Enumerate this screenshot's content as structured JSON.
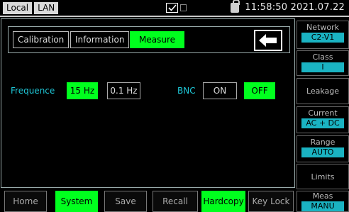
{
  "status": {
    "tags": [
      "Local",
      "LAN"
    ],
    "datetime": "11:58:50 2021.07.22"
  },
  "tabs": [
    {
      "label": "Calibration",
      "active": false
    },
    {
      "label": "Information",
      "active": false
    },
    {
      "label": "Measure",
      "active": true
    }
  ],
  "frequence": {
    "label": "Frequence",
    "options": [
      {
        "label": "15 Hz",
        "active": true
      },
      {
        "label": "0.1 Hz",
        "active": false
      }
    ]
  },
  "bnc": {
    "label": "BNC",
    "options": [
      {
        "label": "ON",
        "active": false
      },
      {
        "label": "OFF",
        "active": true
      }
    ]
  },
  "bottom_menu": [
    {
      "label": "Home",
      "active": false
    },
    {
      "label": "System",
      "active": true
    },
    {
      "label": "Save",
      "active": false
    },
    {
      "label": "Recall",
      "active": false
    },
    {
      "label": "Hardcopy",
      "active": true
    },
    {
      "label": "Key Lock",
      "active": false
    }
  ],
  "softkeys": [
    {
      "label": "Network",
      "value": "C2-V1"
    },
    {
      "label": "Class",
      "value": "I"
    },
    {
      "label": "Leakage",
      "value": null
    },
    {
      "label": "Current",
      "value": "AC + DC"
    },
    {
      "label": "Range",
      "value": "AUTO"
    },
    {
      "label": "Limits",
      "value": null
    },
    {
      "label": "Meas",
      "value": "MANU"
    }
  ],
  "colors": {
    "active": "#00ff1e",
    "accent": "#1ab3c2",
    "label_cyan": "#1ec8d8"
  }
}
